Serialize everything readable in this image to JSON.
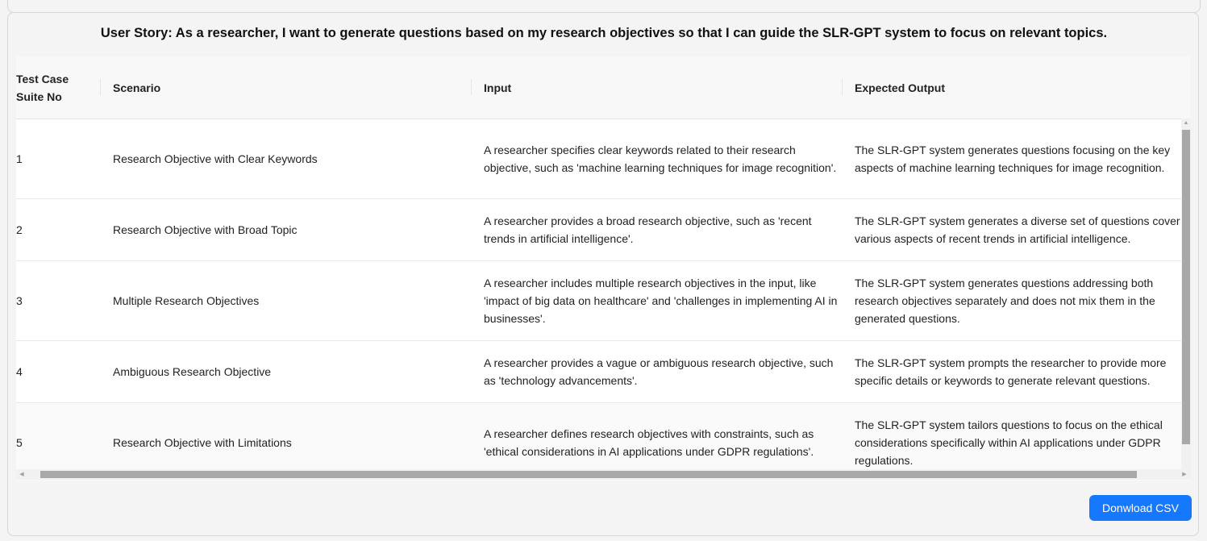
{
  "user_story": "User Story: As a researcher, I want to generate questions based on my research objectives so that I can guide the SLR-GPT system to focus on relevant topics.",
  "table": {
    "columns": [
      "Test Case Suite No",
      "Scenario",
      "Input",
      "Expected Output"
    ],
    "rows": [
      {
        "no": "1",
        "scenario": "Research Objective with Clear Keywords",
        "input": "A researcher specifies clear keywords related to their research objective, such as 'machine learning techniques for image recognition'.",
        "expected": "The SLR-GPT system generates questions focusing on the key aspects of machine learning techniques for image recognition."
      },
      {
        "no": "2",
        "scenario": "Research Objective with Broad Topic",
        "input": "A researcher provides a broad research objective, such as 'recent trends in artificial intelligence'.",
        "expected": "The SLR-GPT system generates a diverse set of questions cover various aspects of recent trends in artificial intelligence."
      },
      {
        "no": "3",
        "scenario": "Multiple Research Objectives",
        "input": "A researcher includes multiple research objectives in the input, like 'impact of big data on healthcare' and 'challenges in implementing AI in businesses'.",
        "expected": "The SLR-GPT system generates questions addressing both research objectives separately and does not mix them in the generated questions."
      },
      {
        "no": "4",
        "scenario": "Ambiguous Research Objective",
        "input": "A researcher provides a vague or ambiguous research objective, such as 'technology advancements'.",
        "expected": "The SLR-GPT system prompts the researcher to provide more specific details or keywords to generate relevant questions."
      },
      {
        "no": "5",
        "scenario": "Research Objective with Limitations",
        "input": "A researcher defines research objectives with constraints, such as 'ethical considerations in AI applications under GDPR regulations'.",
        "expected": "The SLR-GPT system tailors questions to focus on the ethical considerations specifically within AI applications under GDPR regulations."
      }
    ]
  },
  "download_label": "Donwload CSV",
  "colors": {
    "button": "#1677ff",
    "header_bg": "#f8f8f8",
    "row_alt": "#fafafa"
  },
  "icons": {
    "scroll_up": "triangle-up-icon",
    "scroll_down": "triangle-down-icon",
    "scroll_left": "triangle-left-icon",
    "scroll_right": "triangle-right-icon"
  }
}
